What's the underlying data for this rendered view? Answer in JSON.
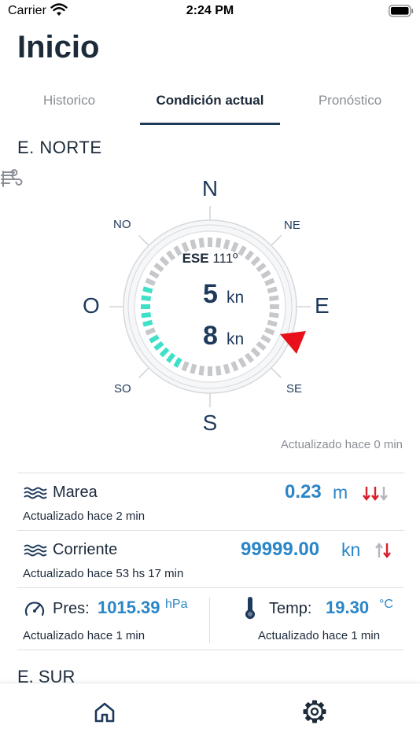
{
  "status": {
    "carrier": "Carrier",
    "time": "2:24 PM"
  },
  "header": {
    "title": "Inicio"
  },
  "tabs": [
    {
      "label": "Historico"
    },
    {
      "label": "Condición actual"
    },
    {
      "label": "Pronóstico"
    }
  ],
  "station": {
    "name": "E. NORTE",
    "compass": {
      "cardinals": {
        "n": "N",
        "ne": "NE",
        "e": "E",
        "se": "SE",
        "s": "S",
        "so": "SO",
        "o": "O",
        "no": "NO"
      },
      "direction": "ESE",
      "degrees": "111º",
      "gust_value": "5",
      "gust_unit": "kn",
      "wind_value": "8",
      "wind_unit": "kn",
      "updated": "Actualizado hace 0 min",
      "accent_color": "#3ee0c8",
      "arrow_color": "#e8101a"
    },
    "marea": {
      "label": "Marea",
      "value": "0.23",
      "unit": "m",
      "updated": "Actualizado hace 2 min"
    },
    "corriente": {
      "label": "Corriente",
      "value": "99999.00",
      "unit": "kn",
      "updated": "Actualizado hace 53 hs 17 min"
    },
    "presion": {
      "label": "Pres:",
      "value": "1015.39",
      "unit": "hPa",
      "updated": "Actualizado hace 1 min"
    },
    "temperatura": {
      "label": "Temp:",
      "value": "19.30",
      "unit": "°C",
      "updated": "Actualizado hace 1 min"
    }
  },
  "next_station": {
    "name": "E. SUR"
  },
  "tabbar": {
    "items": [
      {
        "icon": "home-icon"
      },
      {
        "icon": "gear-icon"
      }
    ]
  }
}
